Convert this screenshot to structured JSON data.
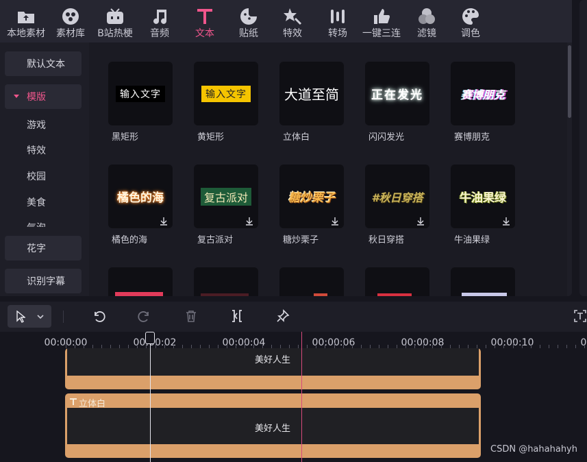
{
  "toolbar": {
    "items": [
      {
        "label": "本地素材",
        "icon": "upload-folder-icon"
      },
      {
        "label": "素材库",
        "icon": "media-library-icon"
      },
      {
        "label": "B站热梗",
        "icon": "bilibili-tv-icon"
      },
      {
        "label": "音频",
        "icon": "music-note-icon"
      },
      {
        "label": "文本",
        "icon": "text-t-icon",
        "active": true
      },
      {
        "label": "贴纸",
        "icon": "sticker-icon"
      },
      {
        "label": "特效",
        "icon": "magic-star-icon"
      },
      {
        "label": "转场",
        "icon": "transition-icon"
      },
      {
        "label": "一键三连",
        "icon": "thumbs-up-icon"
      },
      {
        "label": "滤镜",
        "icon": "filter-circles-icon"
      },
      {
        "label": "调色",
        "icon": "palette-icon"
      }
    ],
    "accent_color": "#f0568c"
  },
  "sidebar": {
    "default_text": "默认文本",
    "template": "模版",
    "sub_items": [
      "游戏",
      "特效",
      "校园",
      "美食",
      "气泡"
    ],
    "fancy_text": "花字",
    "recognize_subtitles": "识别字幕"
  },
  "grid": {
    "cards": [
      {
        "preview": "输入文字",
        "label": "黑矩形"
      },
      {
        "preview": "输入文字",
        "label": "黄矩形"
      },
      {
        "preview": "大道至简",
        "label": "立体白"
      },
      {
        "preview": "正在发光",
        "label": "闪闪发光"
      },
      {
        "preview": "赛博朋克",
        "label": "赛博朋克"
      },
      {
        "preview": "橘色的海",
        "label": "橘色的海",
        "download": true
      },
      {
        "preview": "复古派对",
        "label": "复古派对",
        "download": true
      },
      {
        "preview": "糖炒栗子",
        "label": "糖炒栗子",
        "download": true
      },
      {
        "preview": "#秋日穿搭",
        "label": "秋日穿搭",
        "download": true
      },
      {
        "preview": "牛油果绿",
        "label": "牛油果绿",
        "download": true
      }
    ]
  },
  "timeline": {
    "ticks": [
      "00:00:00",
      "00:00:02",
      "00:00:04",
      "00:00:06",
      "00:00:08",
      "00:00:10"
    ],
    "clips": [
      {
        "name": "",
        "text": "美好人生"
      },
      {
        "name": "立体白",
        "text": "美好人生"
      }
    ],
    "clip_color": "#dba06a"
  },
  "watermark": "CSDN @hahahahyh"
}
